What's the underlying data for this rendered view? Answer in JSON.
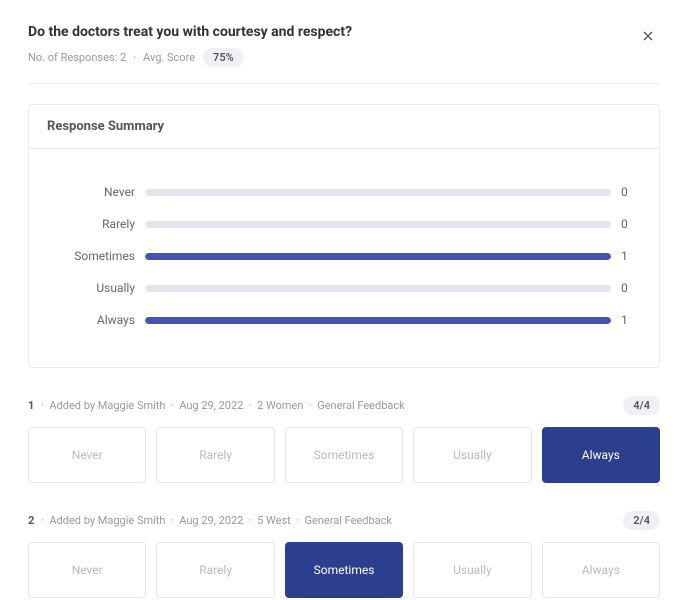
{
  "header": {
    "question": "Do the doctors treat you with courtesy and respect?",
    "responses_label": "No. of Responses: 2",
    "avg_label": "Avg. Score",
    "avg_value": "75%"
  },
  "summary": {
    "title": "Response Summary"
  },
  "chart_data": {
    "type": "bar",
    "categories": [
      "Never",
      "Rarely",
      "Sometimes",
      "Usually",
      "Always"
    ],
    "values": [
      0,
      0,
      1,
      0,
      1
    ],
    "max": 1,
    "title": "Response Summary",
    "xlabel": "",
    "ylabel": ""
  },
  "responses": [
    {
      "index": "1",
      "added_by": "Added by Maggie Smith",
      "date": "Aug 29, 2022",
      "location": "2 Women",
      "category": "General Feedback",
      "score": "4/4",
      "selected": 4,
      "options": [
        "Never",
        "Rarely",
        "Sometimes",
        "Usually",
        "Always"
      ]
    },
    {
      "index": "2",
      "added_by": "Added by Maggie Smith",
      "date": "Aug 29, 2022",
      "location": "5 West",
      "category": "General Feedback",
      "score": "2/4",
      "selected": 2,
      "options": [
        "Never",
        "Rarely",
        "Sometimes",
        "Usually",
        "Always"
      ]
    }
  ]
}
